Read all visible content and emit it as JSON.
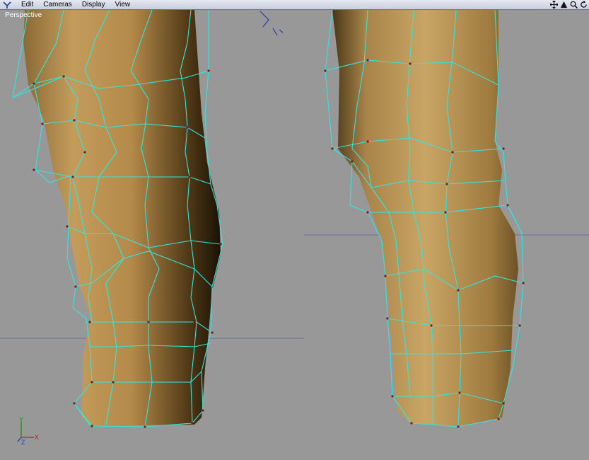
{
  "menu": {
    "items": [
      "Edit",
      "Cameras",
      "Display",
      "View"
    ]
  },
  "toolbar": {
    "icons": [
      "move-view-icon",
      "rotate-view-icon",
      "zoom-view-icon",
      "fit-view-icon"
    ]
  },
  "viewport": {
    "label": "Perspective",
    "axis": {
      "x": "X",
      "y": "Y",
      "z": "Z"
    }
  },
  "colors": {
    "background": "#989898",
    "mesh_skin": "#b48d4f",
    "wireframe": "#31e6df",
    "vertex": "#7a1a10",
    "grid_line": "#6e6ea8"
  }
}
